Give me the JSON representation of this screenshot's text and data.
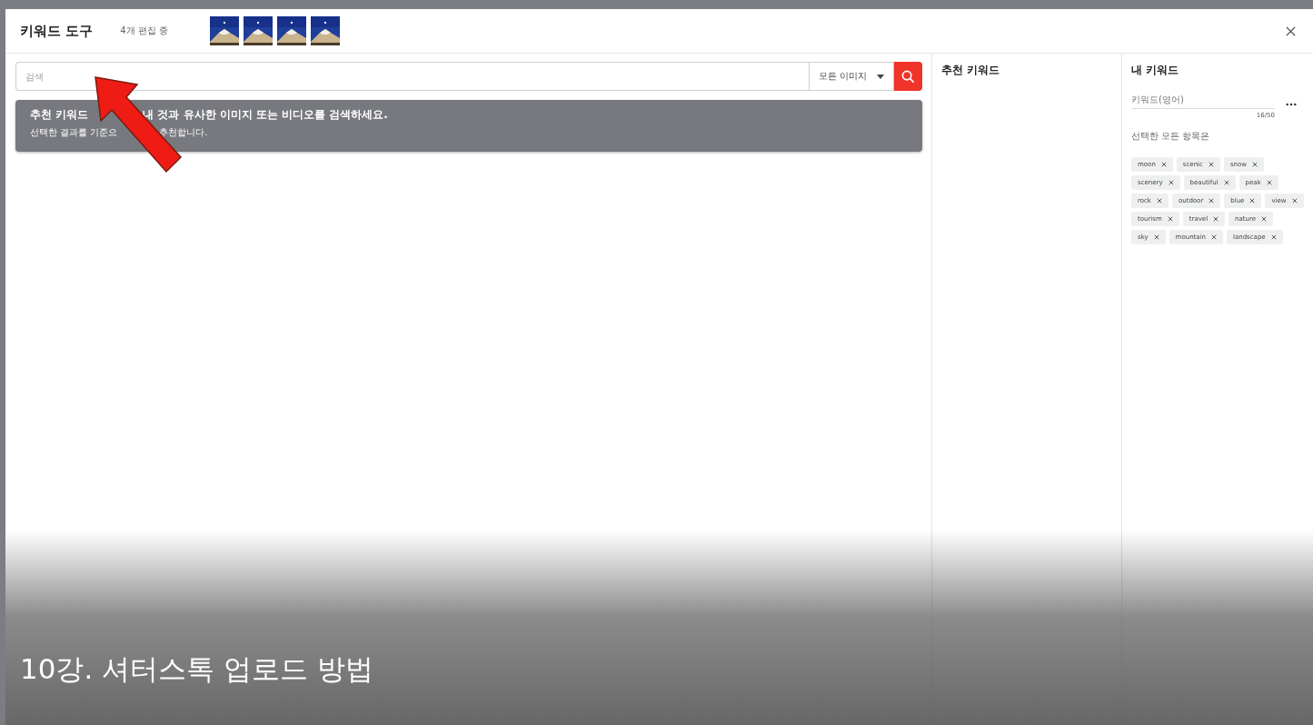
{
  "header": {
    "title": "키워드 도구",
    "subtitle": "4개 편집 중"
  },
  "search": {
    "placeholder": "검색",
    "filter": "모든 이미지"
  },
  "banner": {
    "title_parts": [
      "추천 키워드",
      "내 것과 유사한 이미지 또는 비디오를 검색하세요."
    ],
    "subtitle_parts": [
      "선택한 결과를 기준으",
      "추천합니다."
    ]
  },
  "suggested": {
    "title": "추천 키워드"
  },
  "my_keywords": {
    "title": "내 키워드",
    "placeholder": "키워드(영어)",
    "count": "16/50",
    "note": "선택한 모든 항목은",
    "tags": [
      "moon",
      "scenic",
      "snow",
      "scenery",
      "beautiful",
      "peak",
      "rock",
      "outdoor",
      "blue",
      "view",
      "tourism",
      "travel",
      "nature",
      "sky",
      "mountain",
      "landscape"
    ]
  },
  "caption": "10강. 셔터스톡 업로드 방법"
}
